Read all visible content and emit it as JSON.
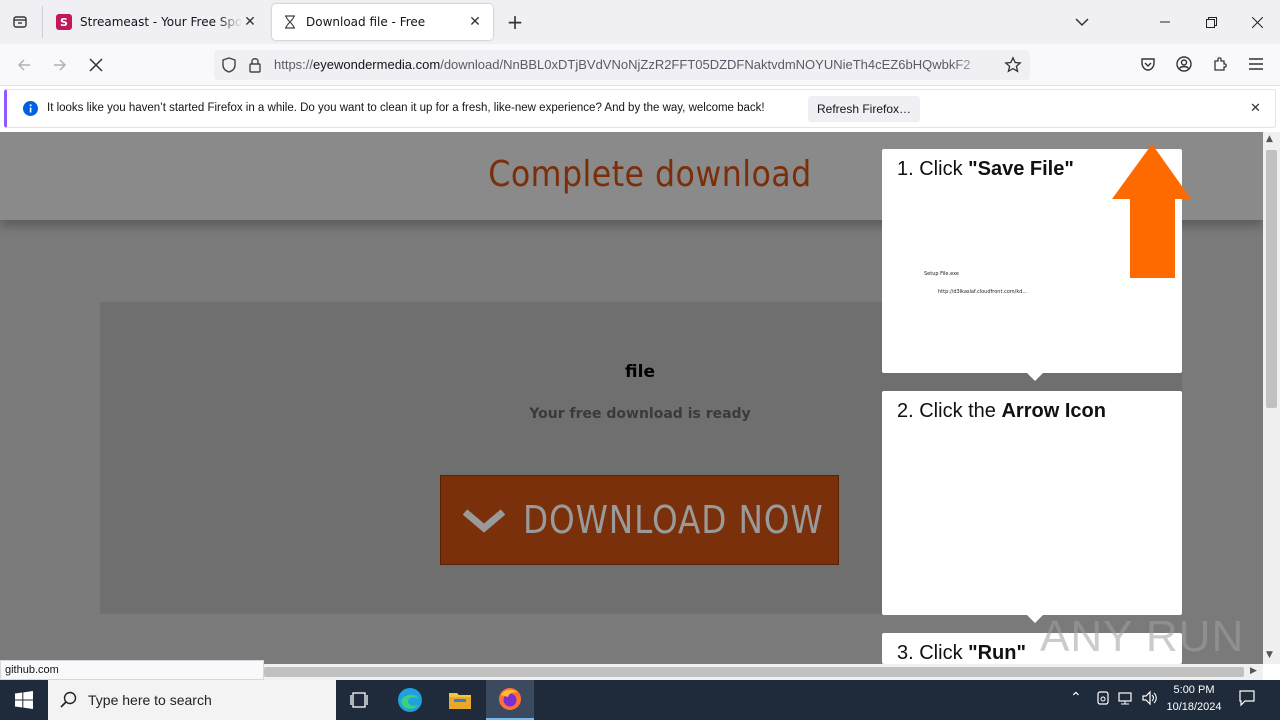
{
  "browser": {
    "tabs": [
      {
        "title": "Streameast - Your Free Sports St",
        "favicon_letter": "S",
        "active": false
      },
      {
        "title": "Download file - Free",
        "active": true
      }
    ],
    "url_domain": "eyewondermedia.com",
    "url_prefix": "https://",
    "url_path": "/download/NnBBL0xDTjBVdVNoNjZzR2FFT05DZDFNaktvdmNOYUNieTh4cEZ6bHQwbkF2",
    "notification": {
      "text": "It looks like you haven’t started Firefox in a while. Do you want to clean it up for a fresh, like-new experience? And by the way, welcome back!",
      "button": "Refresh Firefox…"
    },
    "status_url": "github.com"
  },
  "page": {
    "title": "Complete download",
    "file_label": "file",
    "ready_label": "Your free download is ready",
    "download_button": "DOWNLOAD NOW"
  },
  "instructions": {
    "step1_prefix": "1. Click ",
    "step1_bold": "\"Save File\"",
    "step1_dialog_title": "Setup File.exe",
    "step1_dialog_url": "http://d3lkaslaf.cloudfront.com/kd...",
    "step2_prefix": "2. Click the ",
    "step2_bold": "Arrow Icon",
    "step3_prefix": "3. Click ",
    "step3_bold": "\"Run\"",
    "arrow_color": "#ff6a00"
  },
  "watermark": "ANY RUN",
  "taskbar": {
    "search_placeholder": "Type here to search",
    "time": "5:00 PM",
    "date": "10/18/2024"
  }
}
